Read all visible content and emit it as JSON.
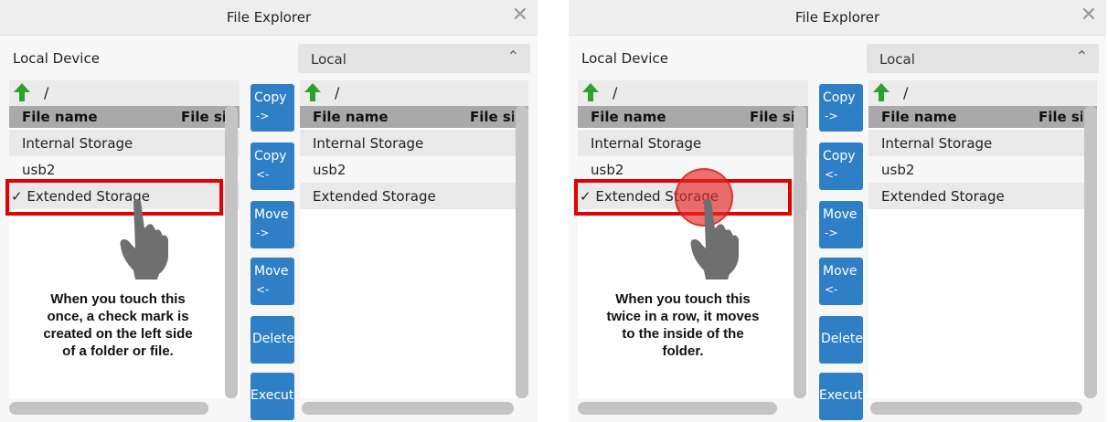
{
  "panels": [
    {
      "title": "File Explorer",
      "local_device_label": "Local Device",
      "select_value": "Local",
      "left_list": {
        "path": "/",
        "headers": [
          "File name",
          "File si"
        ],
        "rows": [
          "Internal Storage",
          "usb2",
          "✓ Extended Storage"
        ]
      },
      "right_list": {
        "path": "/",
        "headers": [
          "File name",
          "File si"
        ],
        "rows": [
          "Internal Storage",
          "usb2",
          "Extended Storage"
        ]
      },
      "buttons": [
        {
          "line1": "Copy",
          "line2": "->"
        },
        {
          "line1": "Copy",
          "line2": "<-"
        },
        {
          "line1": "Move",
          "line2": "->"
        },
        {
          "line1": "Move",
          "line2": "<-"
        },
        {
          "line1": "Delete",
          "line2": ""
        },
        {
          "line1": "Execute",
          "line2": ""
        }
      ],
      "caption": [
        "When you touch this",
        "once, a check mark is",
        "created on the left side",
        "of a folder or file."
      ]
    },
    {
      "title": "File Explorer",
      "local_device_label": "Local Device",
      "select_value": "Local",
      "left_list": {
        "path": "/",
        "headers": [
          "File name",
          "File si"
        ],
        "rows": [
          "Internal Storage",
          "usb2",
          "✓ Extended Storage"
        ]
      },
      "right_list": {
        "path": "/",
        "headers": [
          "File name",
          "File si"
        ],
        "rows": [
          "Internal Storage",
          "usb2",
          "Extended Storage"
        ]
      },
      "buttons": [
        {
          "line1": "Copy",
          "line2": "->"
        },
        {
          "line1": "Copy",
          "line2": "<-"
        },
        {
          "line1": "Move",
          "line2": "->"
        },
        {
          "line1": "Move",
          "line2": "<-"
        },
        {
          "line1": "Delete",
          "line2": ""
        },
        {
          "line1": "Execute",
          "line2": ""
        }
      ],
      "caption": [
        "When you touch this",
        "twice in a row, it moves",
        "to the inside of the",
        "folder."
      ]
    }
  ],
  "icons": {
    "up": "up-arrow-icon",
    "close": "close-icon",
    "select_arrows": "updown-chevron-icon",
    "hand": "hand-pointer-icon"
  },
  "colors": {
    "button": "#2f7fc7",
    "highlight": "#e40000",
    "header": "#a9a9a9",
    "up_arrow": "#2da12d"
  }
}
